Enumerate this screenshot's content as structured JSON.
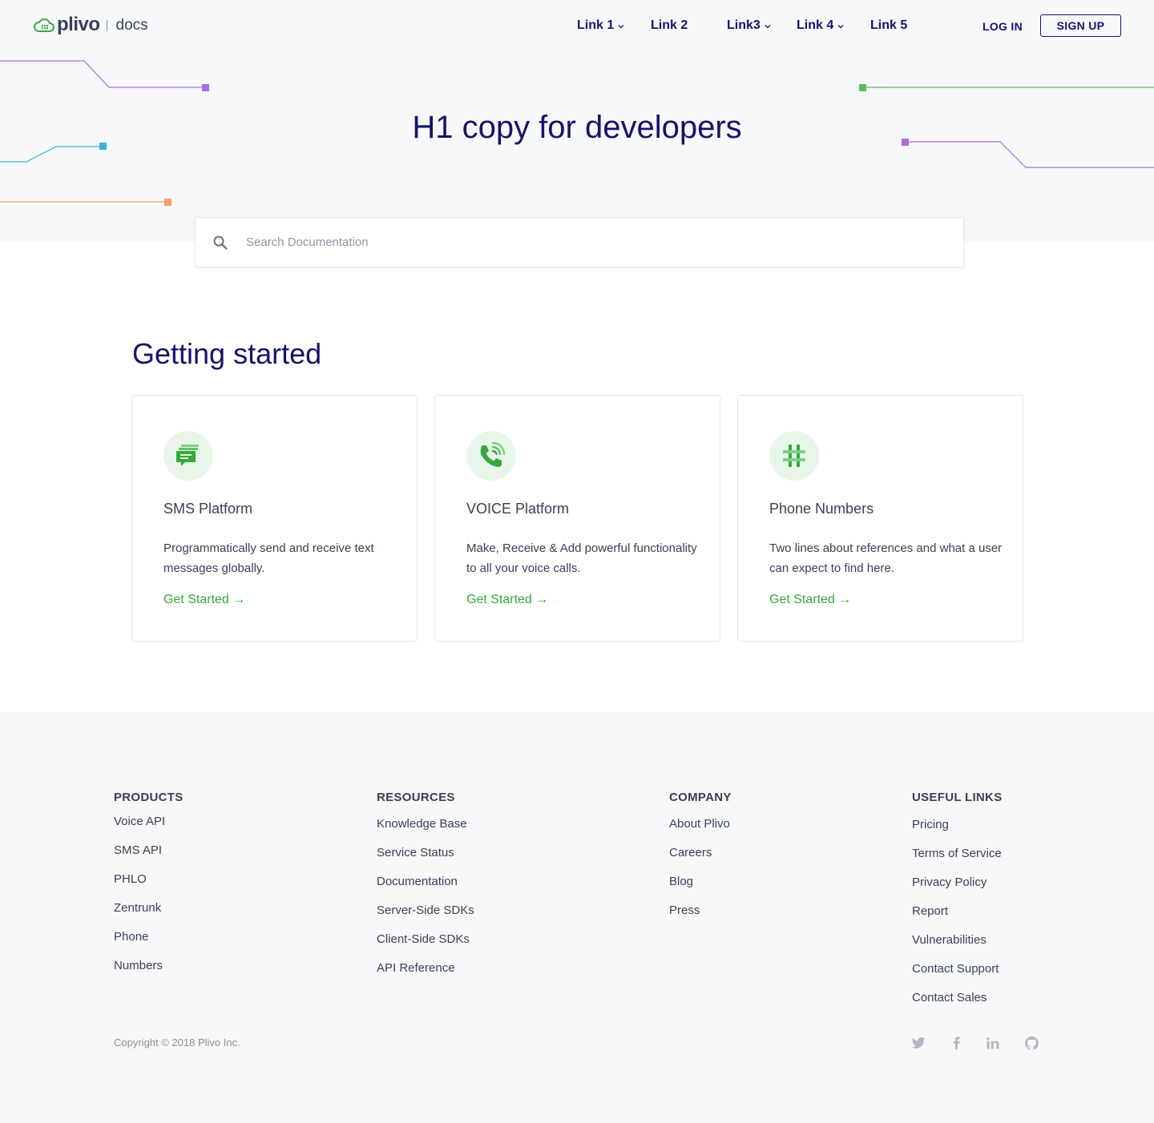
{
  "header": {
    "logo_text": "plivo",
    "logo_section": "docs",
    "nav": [
      {
        "label": "Link 1",
        "has_dropdown": true
      },
      {
        "label": "Link 2",
        "has_dropdown": false
      },
      {
        "label": "Link3",
        "has_dropdown": true
      },
      {
        "label": "Link 4",
        "has_dropdown": true
      },
      {
        "label": "Link 5",
        "has_dropdown": false
      }
    ],
    "login_label": "LOG IN",
    "signup_label": "SIGN UP"
  },
  "hero": {
    "title": "H1 copy for developers",
    "search_placeholder": "Search Documentation"
  },
  "getting_started": {
    "title": "Getting started",
    "cards": [
      {
        "icon": "sms-icon",
        "title": "SMS Platform",
        "description": "Programmatically send and receive text messages globally.",
        "link": "Get Started →"
      },
      {
        "icon": "phone-call-icon",
        "title": "VOICE Platform",
        "description": "Make, Receive & Add powerful functionality to all your voice calls.",
        "link": "Get Started →"
      },
      {
        "icon": "hash-icon",
        "title": "Phone Numbers",
        "description": "Two lines about references and what a user can expect to find here.",
        "link": "Get Started →"
      }
    ]
  },
  "footer": {
    "columns": [
      {
        "heading": "PRODUCTS",
        "items": [
          "Voice API",
          "SMS API",
          "PHLO",
          "Zentrunk",
          "Phone",
          "Numbers"
        ]
      },
      {
        "heading": "RESOURCES",
        "items": [
          "Knowledge Base",
          "Service Status",
          "Documentation",
          "Server-Side SDKs",
          "Client-Side SDKs",
          "API Reference"
        ]
      },
      {
        "heading": "COMPANY",
        "items": [
          "About Plivo",
          "Careers",
          "Blog",
          "Press"
        ]
      },
      {
        "heading": "USEFUL LINKS",
        "items": [
          "Pricing",
          "Terms of Service",
          "Privacy Policy",
          "Report",
          "Vulnerabilities",
          "Contact Support",
          "Contact Sales"
        ]
      }
    ],
    "copyright": "Copyright © 2018 Plivo Inc.",
    "social": [
      "twitter-icon",
      "facebook-icon",
      "linkedin-icon",
      "github-icon"
    ]
  },
  "colors": {
    "brand_navy": "#14146b",
    "accent_green": "#36a83e",
    "text": "#3b3f54",
    "hero_bg": "#f7f8fa"
  }
}
